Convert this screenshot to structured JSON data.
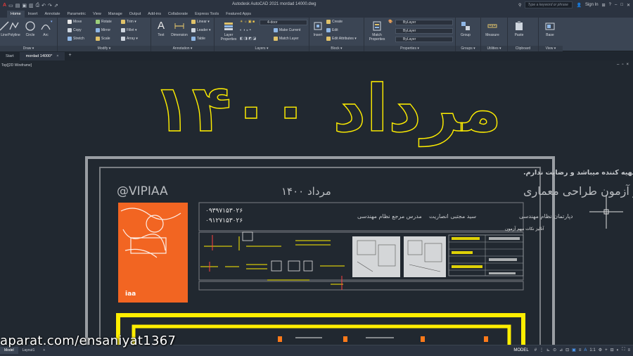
{
  "titlebar": {
    "title": "Autodesk AutoCAD 2021    mordad 14000.dwg",
    "search_placeholder": "Type a keyword or phrase",
    "signin": "Sign In"
  },
  "ribbon_tabs": [
    "Home",
    "Insert",
    "Annotate",
    "Parametric",
    "View",
    "Manage",
    "Output",
    "Add-ins",
    "Collaborate",
    "Express Tools",
    "Featured Apps"
  ],
  "panels": {
    "draw": {
      "label": "Draw ▾",
      "tools": [
        "Line",
        "Polyline",
        "Circle",
        "Arc"
      ]
    },
    "modify": {
      "label": "Modify ▾",
      "tools": [
        "Move",
        "Rotate",
        "Trim ▾",
        "Copy",
        "Mirror",
        "Fillet ▾",
        "Stretch",
        "Scale",
        "Array ▾"
      ]
    },
    "annotation": {
      "label": "Annotation ▾",
      "tools": [
        "Text",
        "Dimension",
        "Linear ▾",
        "Leader ▾",
        "Table"
      ]
    },
    "layers": {
      "label": "Layers ▾",
      "layer_properties": "Layer Properties",
      "current_layer": "4-door",
      "make_current": "Make Current",
      "match_layer": "Match Layer"
    },
    "block": {
      "label": "Block ▾",
      "insert": "Insert",
      "tools": [
        "Create",
        "Edit",
        "Edit Attributes ▾"
      ]
    },
    "properties": {
      "label": "Properties ▾",
      "match": "Match Properties",
      "color": "ByLayer",
      "linetype": "ByLayer",
      "lineweight": "ByLayer"
    },
    "groups": {
      "label": "Groups ▾",
      "tool": "Group"
    },
    "utilities": {
      "label": "Utilities ▾",
      "tool": "Measure"
    },
    "clipboard": {
      "label": "Clipboard",
      "tool": "Paste"
    },
    "view": {
      "label": "View ▾",
      "tool": "Base"
    }
  },
  "file_tabs": {
    "start": "Start",
    "drawing": "mordad 14000*",
    "close": "×",
    "add": "+"
  },
  "viewport": {
    "label": "Top][2D Wireframe]"
  },
  "drawing": {
    "big_title": "مرداد ۱۴۰۰",
    "notice": "لطفا توجه کنید دیدن این آنالیزها توسط اشخاصی که هزینه پرداخت نکردند اجحاف در حق تهیه کننده میباشد و رضایت ندارم.",
    "handle": "@VIPIAA",
    "date_label": "مرداد ۱۴۰۰",
    "heading": "آنالیز آزمون طراحی معماری",
    "phone1": "۰۹۳۹۷۱۵۳۰۲۶",
    "phone2": "۰۹۱۲۷۱۵۳۰۲۶",
    "teacher_label": "مدرس مرجع نظام مهندسی",
    "teacher_name": "سید مجتبی انصاریت",
    "org_label": "دپارتمان نظام مهندسی",
    "sub_heading": "آنالیز نکات مهم آزمون",
    "cover_logo": "iaa"
  },
  "statusbar": {
    "layout_tabs": [
      "Model",
      "Layout1"
    ],
    "model": "MODEL",
    "plus": "+"
  },
  "watermark": "aparat.com/ensaniyat1367",
  "colors": {
    "background": "#212830",
    "yellow": "#ffee00",
    "orange": "#f26522",
    "grey_border": "#8a8d91"
  }
}
